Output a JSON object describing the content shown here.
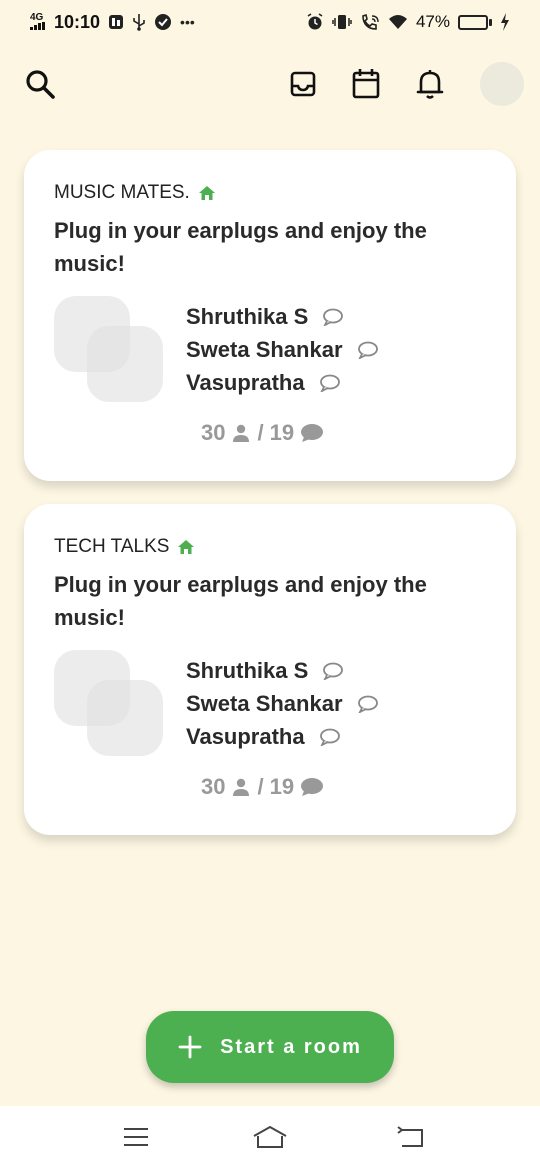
{
  "status_bar": {
    "network": "4G",
    "time": "10:10",
    "battery_percent": "47%",
    "battery_level": 0.47
  },
  "colors": {
    "background": "#fcf6e2",
    "card": "#ffffff",
    "accent_green": "#4caf50",
    "muted_text": "#999999"
  },
  "topbar": {
    "icons": [
      "search-icon",
      "inbox-icon",
      "calendar-icon",
      "bell-icon",
      "profile-avatar"
    ]
  },
  "rooms": [
    {
      "label": "MUSIC MATES.",
      "description": "Plug in your earplugs and enjoy the music!",
      "members": [
        "Shruthika S",
        "Sweta Shankar",
        "Vasupratha"
      ],
      "listeners": "30",
      "chats": "19"
    },
    {
      "label": "TECH TALKS",
      "description": "Plug in your earplugs and enjoy the music!",
      "members": [
        "Shruthika S",
        "Sweta Shankar",
        "Vasupratha"
      ],
      "listeners": "30",
      "chats": "19"
    }
  ],
  "start_button": {
    "label": "Start a room"
  },
  "navbar": {
    "icons": [
      "menu-icon",
      "home-icon",
      "back-icon"
    ]
  }
}
